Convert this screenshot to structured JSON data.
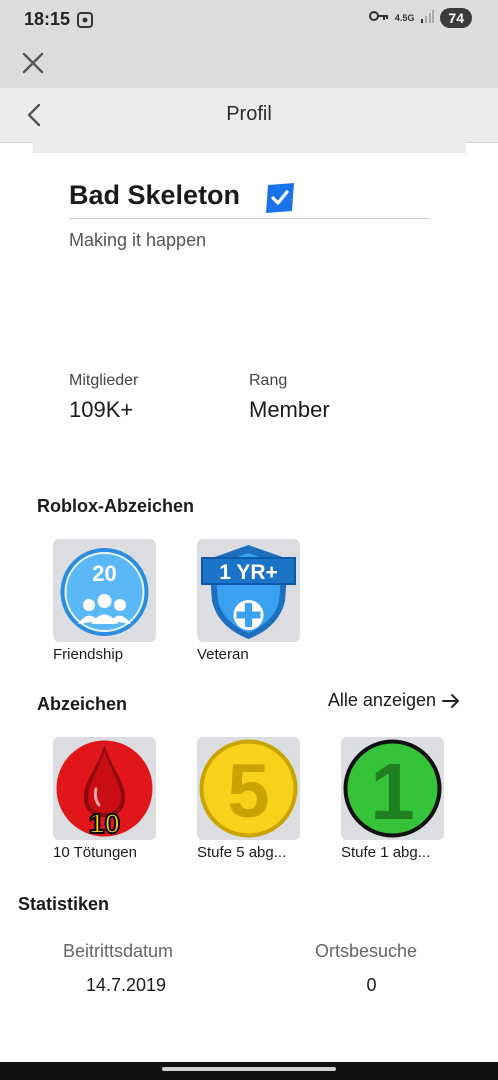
{
  "status": {
    "time": "18:15",
    "network": "4.5G",
    "battery": "74"
  },
  "nav": {
    "title": "Profil"
  },
  "group": {
    "name": "Bad Skeleton",
    "tagline": "Making it happen"
  },
  "stats": {
    "members_label": "Mitglieder",
    "members_value": "109K+",
    "rank_label": "Rang",
    "rank_value": "Member"
  },
  "roblox_badges": {
    "title": "Roblox-Abzeichen",
    "items": [
      {
        "label": "Friendship",
        "icon_text": "20"
      },
      {
        "label": "Veteran",
        "icon_text": "1 YR+"
      }
    ]
  },
  "badges": {
    "title": "Abzeichen",
    "see_all": "Alle anzeigen",
    "items": [
      {
        "label": "10 Tötungen",
        "icon_text": "10"
      },
      {
        "label": "Stufe 5 abg...",
        "icon_text": "5"
      },
      {
        "label": "Stufe 1 abg...",
        "icon_text": "1"
      }
    ]
  },
  "statistics": {
    "title": "Statistiken",
    "join_label": "Beitrittsdatum",
    "join_value": "14.7.2019",
    "visits_label": "Ortsbesuche",
    "visits_value": "0"
  },
  "colors": {
    "verified": "#1a73e8",
    "friendship": "#3da5f4",
    "veteran": "#2d7fd3",
    "kills": "#e0161b",
    "stage5": "#f7d11a",
    "stage1": "#35c33a"
  }
}
